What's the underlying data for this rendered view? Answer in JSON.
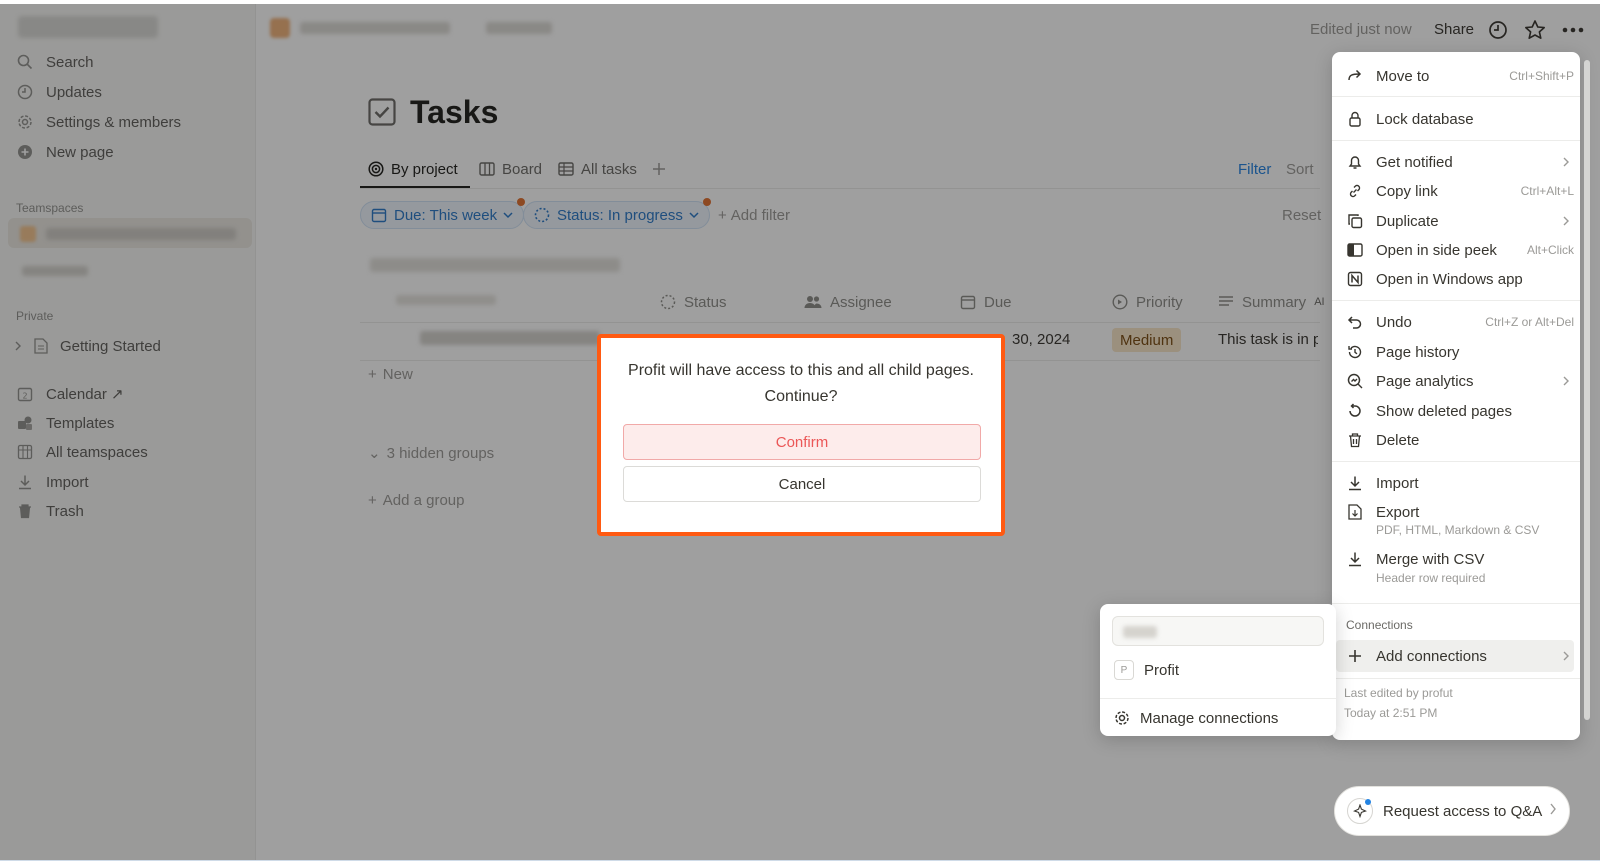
{
  "topbar": {
    "edited_label": "Edited just now",
    "share_label": "Share",
    "icons": [
      "clock-icon",
      "star-icon",
      "more-icon"
    ]
  },
  "sidebar": {
    "items": [
      {
        "label": "Search",
        "icon": "search-icon"
      },
      {
        "label": "Updates",
        "icon": "clock-icon"
      },
      {
        "label": "Settings & members",
        "icon": "gear-icon"
      },
      {
        "label": "New page",
        "icon": "plus-circle-icon"
      }
    ],
    "teamspaces_label": "Teamspaces",
    "private_label": "Private",
    "private_items": [
      {
        "label": "Getting Started",
        "icon": "page-icon"
      }
    ],
    "bottom_items": [
      {
        "label": "Calendar ↗",
        "icon": "calendar-icon"
      },
      {
        "label": "Templates",
        "icon": "templates-icon"
      },
      {
        "label": "All teamspaces",
        "icon": "grid-icon"
      },
      {
        "label": "Import",
        "icon": "download-icon"
      },
      {
        "label": "Trash",
        "icon": "trash-icon"
      }
    ]
  },
  "page": {
    "title": "Tasks",
    "title_icon": "checkbox-icon",
    "views": [
      {
        "label": "By project",
        "icon": "target-icon"
      },
      {
        "label": "Board",
        "icon": "board-icon"
      },
      {
        "label": "All tasks",
        "icon": "table-icon"
      }
    ],
    "filter_label": "Filter",
    "sort_label": "Sort",
    "filters": [
      {
        "label": "Due: This week"
      },
      {
        "label": "Status: In progress"
      }
    ],
    "add_filter_label": "Add filter",
    "reset_label": "Reset",
    "columns": [
      "Status",
      "Assignee",
      "Due",
      "Priority",
      "Summary"
    ],
    "summary_ai_tag": "AI",
    "row": {
      "due": "30, 2024",
      "priority": "Medium",
      "summary": "This task is in pro"
    },
    "new_label": "New",
    "hidden_groups_label": "3 hidden groups",
    "add_group_label": "Add a group"
  },
  "menu": {
    "items": [
      {
        "label": "Move to",
        "shortcut": "Ctrl+Shift+P",
        "icon": "arrow-right-icon"
      },
      {
        "label": "Lock database",
        "icon": "lock-icon"
      },
      {
        "label": "Get notified",
        "icon": "bell-icon"
      },
      {
        "label": "Copy link",
        "shortcut": "Ctrl+Alt+L",
        "icon": "link-icon"
      },
      {
        "label": "Duplicate",
        "icon": "duplicate-icon"
      },
      {
        "label": "Open in side peek",
        "shortcut": "Alt+Click",
        "icon": "side-peek-icon"
      },
      {
        "label": "Open in Windows app",
        "icon": "notion-app-icon"
      },
      {
        "label": "Undo",
        "shortcut": "Ctrl+Z or Alt+Del",
        "icon": "undo-icon"
      },
      {
        "label": "Page history",
        "icon": "history-icon"
      },
      {
        "label": "Page analytics",
        "icon": "analytics-icon"
      },
      {
        "label": "Show deleted pages",
        "icon": "restore-icon"
      },
      {
        "label": "Delete",
        "icon": "trash-icon"
      },
      {
        "label": "Import",
        "icon": "download-icon"
      },
      {
        "label": "Export",
        "sub": "PDF, HTML, Markdown & CSV",
        "icon": "export-icon"
      },
      {
        "label": "Merge with CSV",
        "sub": "Header row required",
        "icon": "merge-icon"
      }
    ],
    "connections_label": "Connections",
    "add_connections_label": "Add connections",
    "last_edited_line": "Last edited by profut",
    "last_edited_time": "Today at 2:51 PM"
  },
  "connections_submenu": {
    "items": [
      {
        "label": "Profit",
        "logo": "P"
      },
      {
        "label": "Manage connections",
        "icon": "gear-icon"
      }
    ]
  },
  "request_access": {
    "label": "Request access to Q&A"
  },
  "modal": {
    "message": "Profit will have access to this and all child pages. Continue?",
    "confirm_label": "Confirm",
    "cancel_label": "Cancel"
  },
  "colors": {
    "accent": "#2383e2",
    "danger": "#eb5757",
    "highlight_border": "#ff5a12",
    "priority_medium_bg": "#f8e6c8"
  }
}
